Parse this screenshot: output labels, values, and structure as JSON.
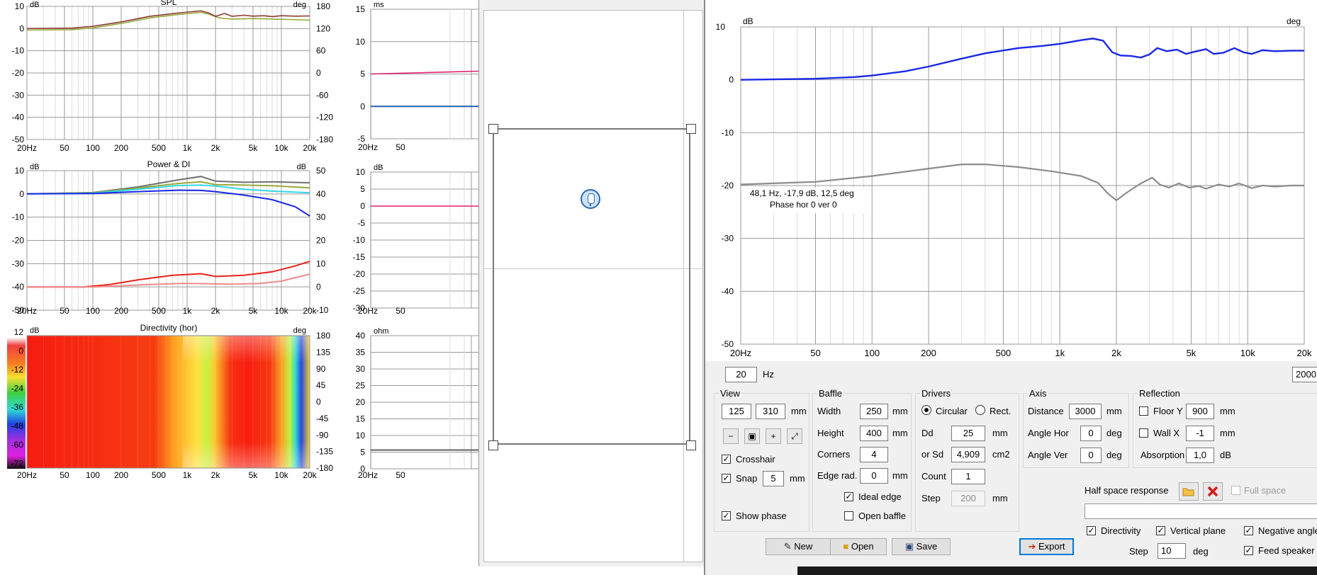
{
  "colors": {
    "blue": "#1a28e6",
    "gray": "#8c8c8c",
    "red": "#e8241c",
    "pink": "#f08a8a",
    "olive": "#99a83a",
    "brown": "#8c3c30",
    "cyan": "#31d6e8",
    "darkgray": "#707070"
  },
  "freq_ticks": [
    "20Hz",
    "50",
    "100",
    "200",
    "500",
    "1k",
    "2k",
    "5k",
    "10k",
    "20k"
  ],
  "spl_chart": {
    "title": "SPL",
    "left_unit": "dB",
    "right_unit": "deg",
    "y_left": [
      "10",
      "0",
      "-10",
      "-20",
      "-30",
      "-40",
      "-50"
    ],
    "y_right": [
      "180",
      "120",
      "60",
      "0",
      "-60",
      "-120",
      "-180"
    ]
  },
  "power_chart": {
    "title": "Power & DI",
    "left_unit": "dB",
    "right_unit": "dB",
    "y_left": [
      "10",
      "0",
      "-10",
      "-20",
      "-30",
      "-40",
      "-50"
    ],
    "y_right": [
      "50",
      "40",
      "30",
      "20",
      "10",
      "0",
      "-10"
    ]
  },
  "dir_chart": {
    "title": "Directivity (hor)",
    "left_unit": "dB",
    "right_unit": "deg",
    "scale": [
      "12",
      "0",
      "-12",
      "-24",
      "-36",
      "-48",
      "-60",
      "-72"
    ],
    "y_right": [
      "180",
      "135",
      "90",
      "45",
      "0",
      "-45",
      "-90",
      "-135",
      "-180"
    ]
  },
  "ms_chart": {
    "unit": "ms",
    "y": [
      "15",
      "10",
      "5",
      "0",
      "-5"
    ],
    "x_first": "20Hz",
    "x_second": "50"
  },
  "db2_chart": {
    "unit": "dB",
    "y": [
      "10",
      "5",
      "0",
      "-5",
      "-10",
      "-15",
      "-20",
      "-25",
      "-30"
    ],
    "x_first": "20Hz",
    "x_second": "50"
  },
  "ohm_chart": {
    "unit": "ohm",
    "y": [
      "40",
      "35",
      "30",
      "25",
      "20",
      "15",
      "10",
      "5",
      "0"
    ],
    "x_first": "20Hz",
    "x_second": "50"
  },
  "bottom_partial_ticks": [
    "100",
    "200",
    "500",
    "1k",
    "2k",
    "5k",
    "10k",
    "20k"
  ],
  "main_chart": {
    "left_unit": "dB",
    "right_unit": "deg",
    "y": [
      "10",
      "0",
      "-10",
      "-20",
      "-30",
      "-40",
      "-50"
    ],
    "x": [
      "20Hz",
      "50",
      "100",
      "200",
      "500",
      "1k",
      "2k",
      "5k",
      "10k",
      "20k"
    ],
    "tooltip_line1": "48,1 Hz, -17,9 dB, 12,5 deg",
    "tooltip_line2": "Phase hor 0 ver 0"
  },
  "freq_range": {
    "min": "20",
    "unit": "Hz",
    "max": "2000"
  },
  "view": {
    "title": "View",
    "w": "125",
    "h": "310",
    "unit": "mm",
    "crosshair": "Crosshair",
    "snap": "Snap",
    "snap_val": "5",
    "snap_unit": "mm",
    "show_phase": "Show phase"
  },
  "baffle": {
    "title": "Baffle",
    "width_label": "Width",
    "width": "250",
    "height_label": "Height",
    "height": "400",
    "corners_label": "Corners",
    "corners": "4",
    "edge_label": "Edge rad.",
    "edge": "0",
    "unit": "mm",
    "ideal_edge": "Ideal edge",
    "open_baffle": "Open baffle"
  },
  "drivers": {
    "title": "Drivers",
    "circular": "Circular",
    "rect": "Rect.",
    "dd_label": "Dd",
    "dd": "25",
    "dd_unit": "mm",
    "sd_label": "or Sd",
    "sd": "4,909",
    "sd_unit": "cm2",
    "count_label": "Count",
    "count": "1",
    "step_label": "Step",
    "step": "200",
    "step_unit": "mm"
  },
  "axis": {
    "title": "Axis",
    "distance_label": "Distance",
    "distance": "3000",
    "distance_unit": "mm",
    "angle_hor_label": "Angle Hor",
    "angle_hor": "0",
    "angle_ver_label": "Angle Ver",
    "angle_ver": "0",
    "deg": "deg"
  },
  "reflection": {
    "title": "Reflection",
    "floor_label": "Floor Y",
    "floor": "900",
    "floor_unit": "mm",
    "wall_label": "Wall  X",
    "wall": "-1",
    "wall_unit": "mm",
    "absorption_label": "Absorption",
    "absorption": "1,0",
    "absorption_unit": "dB"
  },
  "half_space": {
    "label": "Half space response",
    "full_space": "Full space"
  },
  "options": {
    "directivity": "Directivity",
    "vertical_plane": "Vertical plane",
    "negative_angles": "Negative angles",
    "step_label": "Step",
    "step": "10",
    "step_unit": "deg",
    "feed_speaker": "Feed speaker"
  },
  "buttons": {
    "new": "New",
    "open": "Open",
    "save": "Save",
    "export": "Export"
  }
}
